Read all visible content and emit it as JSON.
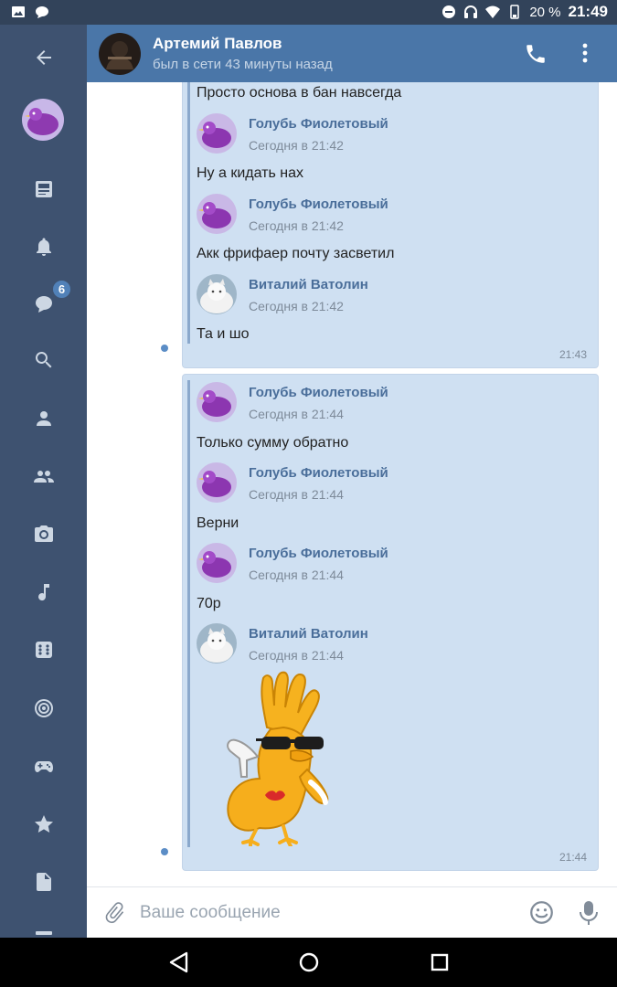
{
  "status_bar": {
    "battery": "20 %",
    "time": "21:49",
    "left_icons": [
      "image-icon",
      "chat-bubble-icon"
    ],
    "right_icons": [
      "alarm-icon",
      "headset-icon",
      "wifi-icon",
      "battery-icon"
    ]
  },
  "sidebar": {
    "items": [
      {
        "name": "back-arrow-icon"
      },
      {
        "name": "profile-avatar"
      },
      {
        "name": "news-icon"
      },
      {
        "name": "notifications-icon"
      },
      {
        "name": "messages-icon",
        "badge": "6"
      },
      {
        "name": "search-icon"
      },
      {
        "name": "friends-icon"
      },
      {
        "name": "communities-icon"
      },
      {
        "name": "photos-icon"
      },
      {
        "name": "music-icon"
      },
      {
        "name": "apps-icon"
      },
      {
        "name": "games-icon"
      },
      {
        "name": "favorites-icon"
      },
      {
        "name": "documents-icon"
      }
    ],
    "badge": "6"
  },
  "header": {
    "name": "Артемий Павлов",
    "status": "был в сети 43 минуты назад"
  },
  "bubble1": {
    "partial_text": "Просто основа в бан навсегда",
    "items": [
      {
        "author": "Голубь Фиолетовый",
        "date": "Сегодня в 21:42",
        "text": "Ну а кидать нах"
      },
      {
        "author": "Голубь Фиолетовый",
        "date": "Сегодня в 21:42",
        "text": "Акк фрифаер почту засветил"
      },
      {
        "author": "Виталий Ватолин",
        "date": "Сегодня в 21:42",
        "text": "Та и шо"
      }
    ],
    "time": "21:43"
  },
  "bubble2": {
    "items": [
      {
        "author": "Голубь Фиолетовый",
        "date": "Сегодня в 21:44",
        "text": "Только сумму обратно"
      },
      {
        "author": "Голубь Фиолетовый",
        "date": "Сегодня в 21:44",
        "text": "Верни"
      },
      {
        "author": "Голубь Фиолетовый",
        "date": "Сегодня в 21:44",
        "text": "70р"
      },
      {
        "author": "Виталий Ватолин",
        "date": "Сегодня в 21:44",
        "text": ""
      }
    ],
    "sticker": "sticker-image",
    "time": "21:44"
  },
  "composer": {
    "placeholder": "Ваше сообщение"
  },
  "colors": {
    "header": "#4a76a8",
    "sidebar": "#3e5270",
    "bubble": "#cfe0f2",
    "author": "#4a6e9a"
  }
}
